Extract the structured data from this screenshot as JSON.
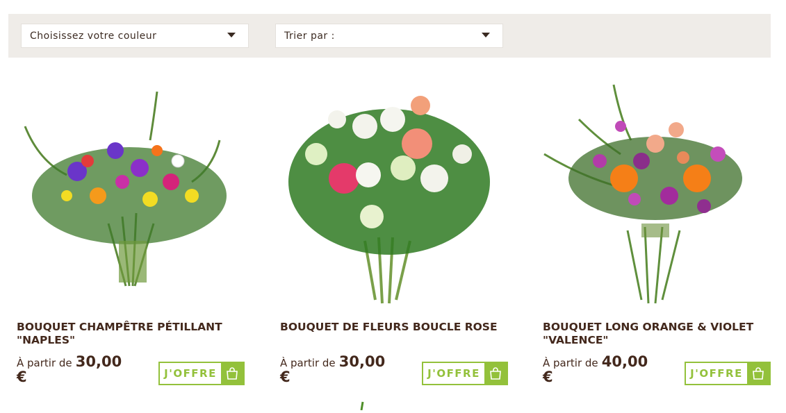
{
  "filters": {
    "color_placeholder": "Choisissez votre couleur",
    "sort_placeholder": "Trier par :"
  },
  "products": [
    {
      "title": "BOUQUET CHAMPÊTRE PÉTILLANT \"NAPLES\"",
      "price_prefix": "À partir de",
      "price": "30,00",
      "currency": "€",
      "cta": "J'OFFRE",
      "image_icon": "flower-bouquet-image"
    },
    {
      "title": "BOUQUET DE FLEURS BOUCLE ROSE",
      "price_prefix": "À partir de",
      "price": "30,00",
      "currency": "€",
      "cta": "J'OFFRE",
      "image_icon": "flower-bouquet-image"
    },
    {
      "title": "BOUQUET LONG ORANGE & VIOLET \"VALENCE\"",
      "price_prefix": "À partir de",
      "price": "40,00",
      "currency": "€",
      "cta": "J'OFFRE",
      "image_icon": "flower-bouquet-image"
    }
  ],
  "colors": {
    "accent_green": "#93c13b",
    "title_brown": "#43281c",
    "filter_bar_bg": "#efece8"
  }
}
